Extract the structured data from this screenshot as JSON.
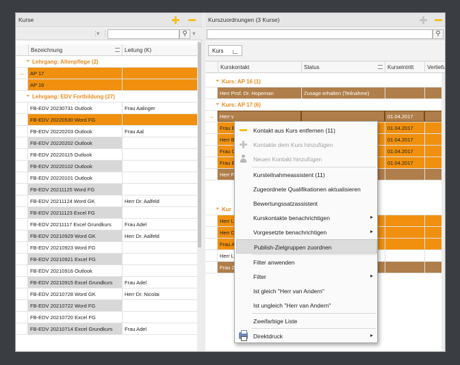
{
  "left": {
    "title": "Kurse",
    "columns": {
      "bezeichnung": "Bezeichnung",
      "leitung": "Leitung (K)"
    },
    "groups": [
      {
        "label": "Lehrgang: Altenpflege (2)"
      },
      {
        "label": "Lehrgang: EDV Fortbildung (27)"
      }
    ],
    "rows_altenpflege": [
      {
        "name": "AP 17",
        "leitung": ""
      },
      {
        "name": "AP 16",
        "leitung": ""
      }
    ],
    "rows_edv": [
      {
        "name": "FB-EDV 20230731 Outlook",
        "leitung": "Frau Aalinger"
      },
      {
        "name": "FB-EDV 20220530 Word FG",
        "leitung": ""
      },
      {
        "name": "FB-EDV 20220203 Outlook",
        "leitung": "Frau Aal"
      },
      {
        "name": "FB-EDV 20220202 Outlook",
        "leitung": ""
      },
      {
        "name": "FB-EDV 20220115 Outlook",
        "leitung": ""
      },
      {
        "name": "FB-EDV 20220102 Outlook",
        "leitung": ""
      },
      {
        "name": "FB-EDV 20220101 Outlook",
        "leitung": ""
      },
      {
        "name": "FB-EDV 20211125 Word FG",
        "leitung": ""
      },
      {
        "name": "FB-EDV 20211124 Word GK",
        "leitung": "Herr Dr. Aalfeld"
      },
      {
        "name": "FB-EDV 20211123 Excel FG",
        "leitung": ""
      },
      {
        "name": "FB-EDV 20211117 Excel Grundkurs",
        "leitung": "Frau Adel"
      },
      {
        "name": "FB-EDV 20210929 Word GK",
        "leitung": "Herr Dr. Aalfeld"
      },
      {
        "name": "FB-EDV 20210923 Word FG",
        "leitung": ""
      },
      {
        "name": "FB-EDV 20210921 Excel FG",
        "leitung": ""
      },
      {
        "name": "FB-EDV 20210916 Outlook",
        "leitung": ""
      },
      {
        "name": "FB-EDV 20210915 Excel Grundkurs",
        "leitung": "Frau Adel"
      },
      {
        "name": "FB-EDV 20210728 Word GK",
        "leitung": "Herr Dr. Nicolai"
      },
      {
        "name": "FB-EDV 20210722 Word FG",
        "leitung": ""
      },
      {
        "name": "FB-EDV 20210720 Excel FG",
        "leitung": ""
      },
      {
        "name": "FB-EDV 20210714 Excel Grundkurs",
        "leitung": "Frau Adel"
      }
    ]
  },
  "right": {
    "title": "Kurszuordnungen (3 Kurse)",
    "group_chip": "Kurs",
    "columns": {
      "kontakt": "Kurskontakt",
      "status": "Status",
      "eintritt": "Kurseintritt",
      "vertiefung": "Vertiefu"
    },
    "group_ap16": "Kurs: AP 16 (1)",
    "group_ap17": "Kurs: AP 17 (6)",
    "group_third": "Kur",
    "row_ap16": {
      "kontakt": "Herr Prof. Dr. Hopeman",
      "status": "Zusage erhalten (Teilnahme)",
      "eintritt": ""
    },
    "rows_ap17": [
      {
        "kontakt": "Herr v",
        "eintritt": "01.04.2017"
      },
      {
        "kontakt": "Frau B",
        "eintritt": "01.04.2017"
      },
      {
        "kontakt": "Herr B",
        "eintritt": "01.04.2017"
      },
      {
        "kontakt": "Frau C",
        "eintritt": "01.04.2017"
      },
      {
        "kontakt": "Frau B",
        "eintritt": "01.04.2017"
      },
      {
        "kontakt": "Herr F",
        "eintritt": ""
      }
    ],
    "rows_third": [
      {
        "kontakt": "Herr L"
      },
      {
        "kontakt": "Herr D"
      },
      {
        "kontakt": "Frau A"
      },
      {
        "kontakt": "Herr L"
      },
      {
        "kontakt": "Frau Z"
      }
    ]
  },
  "context_menu": {
    "items": [
      {
        "label": "Kontakt aus Kurs entfernen (11)"
      },
      {
        "label": "Kontakte dem Kurs hinzufügen"
      },
      {
        "label": "Neuen Kontakt hinzufügen"
      },
      {
        "label": "Kursteilnahmeassistent (11)"
      },
      {
        "label": "Zugeordnete Qualifikationen aktualisieren"
      },
      {
        "label": "Bewertungssatzassistent"
      },
      {
        "label": "Kurskontakte benachrichtigen"
      },
      {
        "label": "Vorgesetzte benachrichtigen"
      },
      {
        "label": "Publish-Zielgruppen zuordnen"
      },
      {
        "label": "Filter anwenden"
      },
      {
        "label": "Filter"
      },
      {
        "label": "Ist gleich \"Herr van Andern\""
      },
      {
        "label": "Ist ungleich \"Herr van Andern\""
      },
      {
        "label": "Zweifarbige Liste"
      },
      {
        "label": "Direktdruck"
      }
    ]
  },
  "colors": {
    "accent": "#f0900e",
    "brown": "#b07e4a",
    "group_text": "#e8891e",
    "icon_yellow": "#f2c11a"
  },
  "icons": [
    "add-icon",
    "remove-icon",
    "search-icon",
    "filter-icon",
    "person-icon",
    "printer-icon",
    "submenu-arrow-icon",
    "row-indicator-icon"
  ]
}
